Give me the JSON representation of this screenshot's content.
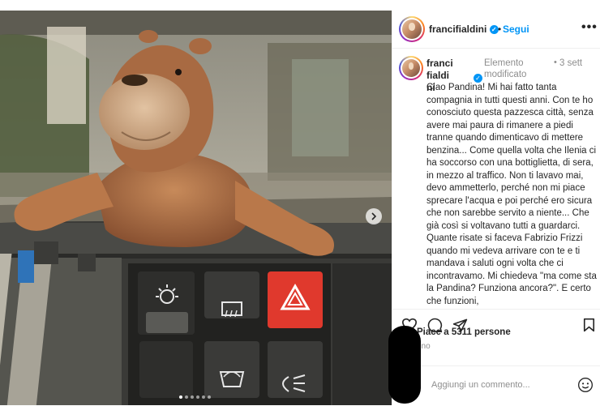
{
  "post": {
    "username": "francifialdini",
    "follow_label": "Segui",
    "more_label": "•••",
    "caption_username": "francifialdini",
    "edited_label": "Elemento modificato",
    "time_label": "3 sett",
    "caption_text": "Ciao Pandina! Mi hai fatto tanta compagnia in tutti questi anni. Con te ho conosciuto questa pazzesca città, senza avere mai paura di rimanere a piedi tranne quando dimenticavo di mettere benzina... Come quella volta che Ilenia ci ha soccorso con una bottiglietta, di sera, in mezzo al traffico. Non ti lavavo mai, devo ammetterlo, perché non mi piace sprecare l'acqua e poi perché ero sicura che non sarebbe servito a niente... Che già così si voltavano tutti a guardarci. Quante risate si faceva Fabrizio Frizzi quando mi vedeva arrivare con te e ti mandava i saluti ogni volta che ci incontravamo. Mi chiedeva \"ma come sta la Pandina? Funziona ancora?\". E certo che funzioni,",
    "likes_label": "Piace a 5311 persone",
    "date_label": "gno",
    "comment_placeholder": "Aggiungi un commento..."
  },
  "icons": {
    "like": "heart-outline-icon",
    "comment": "comment-bubble-icon",
    "share": "paper-plane-icon",
    "save": "bookmark-icon",
    "emoji": "smiley-icon",
    "next": "chevron-right-icon"
  },
  "carousel": {
    "slides": 6,
    "active_index": 0
  },
  "colors": {
    "accent": "#0095f6",
    "verified": "#0095f6",
    "hazard": "#e0392d"
  }
}
